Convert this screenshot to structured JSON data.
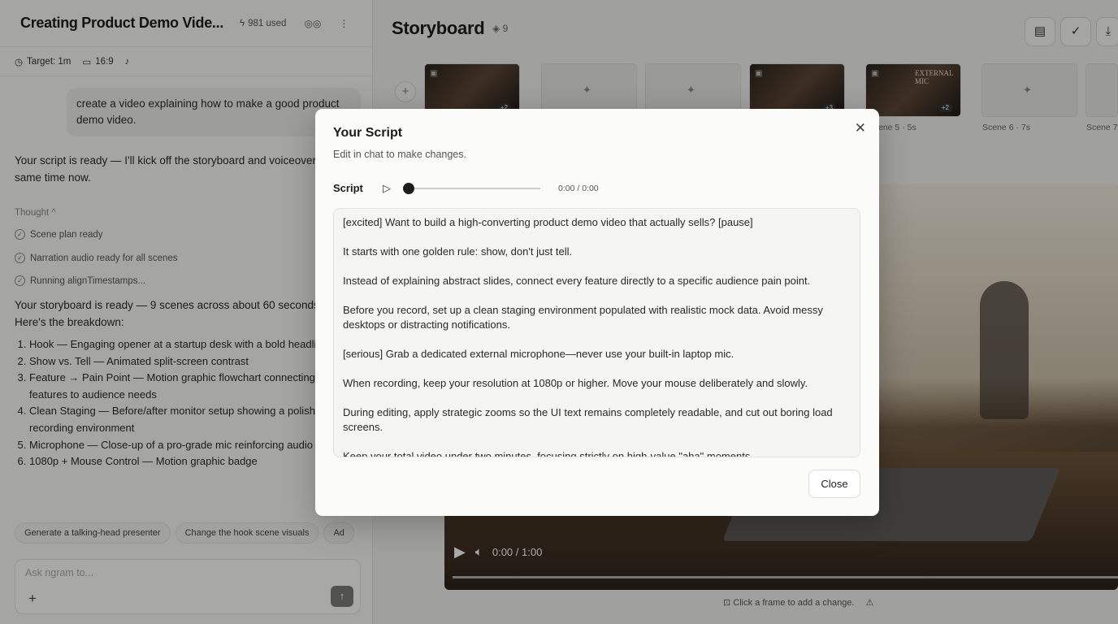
{
  "left": {
    "title": "Creating Product Demo Vide...",
    "usage": "981 used",
    "meta": {
      "target": "Target: 1m",
      "aspect": "16:9"
    },
    "user_message": "create a video explaining how to make a good product demo video.",
    "reply1": "Your script is ready — I'll kick off the storyboard and voiceover at the same time now.",
    "thought_label": "Thought ^",
    "steps": [
      "Scene plan ready",
      "Narration audio ready for all scenes",
      "Running alignTimestamps..."
    ],
    "reply2": "Your storyboard is ready — 9 scenes across about 60 seconds. Here's the breakdown:",
    "breakdown": [
      "Hook — Engaging opener at a startup desk with a bold headline",
      "Show vs. Tell — Animated split-screen contrast",
      "Feature → Pain Point — Motion graphic flowchart connecting features to audience needs",
      "Clean Staging — Before/after monitor setup showing a polished recording environment",
      "Microphone — Close-up of a pro-grade mic reinforcing audio quality",
      "1080p + Mouse Control — Motion graphic badge"
    ],
    "chips": [
      "Generate a talking-head presenter",
      "Change the hook scene visuals",
      "Ad"
    ],
    "input_placeholder": "Ask ngram to..."
  },
  "storyboard": {
    "title": "Storyboard",
    "count": "9",
    "thumb_text": "EXTERNAL MIC",
    "badges": [
      "+2",
      "+3",
      "+2"
    ],
    "scene_labels": [
      "ene 5 · 5s",
      "Scene 6 · 7s",
      "Scene 7"
    ],
    "player_time": "0:00 / 1:00",
    "hint": "Click a frame to add a change."
  },
  "modal": {
    "title": "Your Script",
    "subtitle": "Edit in chat to make changes.",
    "script_label": "Script",
    "time": "0:00 / 0:00",
    "paragraphs": [
      "[excited] Want to build a high-converting product demo video that actually sells? [pause]",
      "It starts with one golden rule: show, don't just tell.",
      "Instead of explaining abstract slides, connect every feature directly to a specific audience pain point.",
      "Before you record, set up a clean staging environment populated with realistic mock data. Avoid messy desktops or distracting notifications.",
      "[serious] Grab a dedicated external microphone—never use your built-in laptop mic.",
      "When recording, keep your resolution at 1080p or higher. Move your mouse deliberately and slowly.",
      "During editing, apply strategic zooms so the UI text remains completely readable, and cut out boring load screens.",
      "Keep your total video under two minutes, focusing strictly on high-value \"aha\" moments."
    ],
    "close_label": "Close"
  }
}
